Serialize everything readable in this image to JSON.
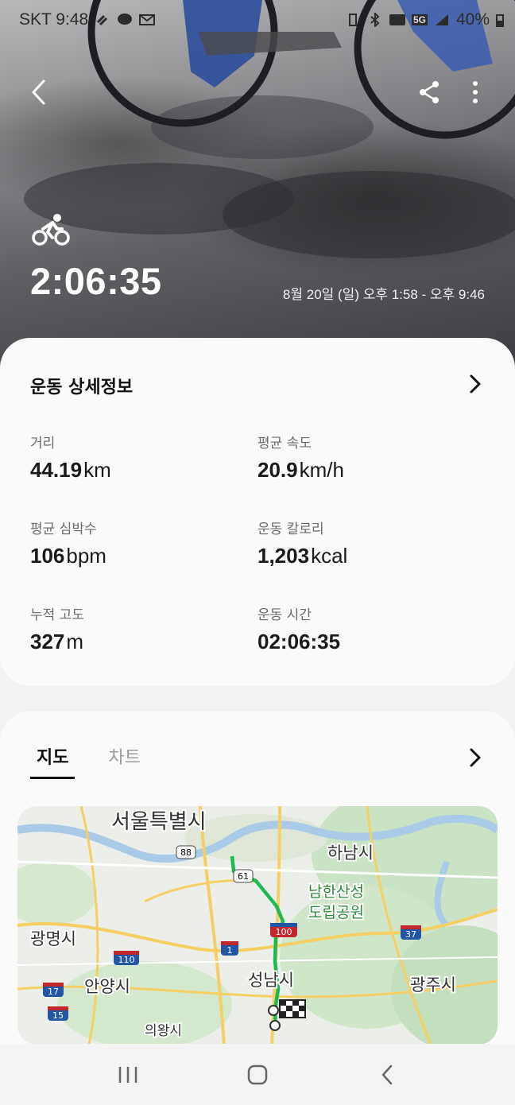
{
  "status_bar": {
    "carrier_time": "SKT 9:48",
    "battery": "40%",
    "network": "5G",
    "icons": [
      "link-icon",
      "talk-icon",
      "mail-icon",
      "vibrate-icon",
      "bluetooth-icon",
      "hd-voice-icon",
      "signal-icon",
      "battery-icon"
    ]
  },
  "header": {
    "activity_icon": "cycling-icon",
    "duration": "2:06:35",
    "date_range": "8월 20일 (일) 오후 1:58 - 오후 9:46"
  },
  "details": {
    "title": "운동 상세정보",
    "metrics": [
      {
        "label": "거리",
        "value": "44.19",
        "unit": "km"
      },
      {
        "label": "평균 속도",
        "value": "20.9",
        "unit": "km/h"
      },
      {
        "label": "평균 심박수",
        "value": "106",
        "unit": "bpm"
      },
      {
        "label": "운동 칼로리",
        "value": "1,203",
        "unit": "kcal"
      },
      {
        "label": "누적 고도",
        "value": "327",
        "unit": "m"
      },
      {
        "label": "운동 시간",
        "value": "02:06:35",
        "unit": ""
      }
    ]
  },
  "map_section": {
    "tabs": [
      {
        "label": "지도",
        "active": true
      },
      {
        "label": "차트",
        "active": false
      }
    ],
    "places": [
      "서울특별시",
      "하남시",
      "남한산성",
      "도립공원",
      "광명시",
      "안양시",
      "성남시",
      "광주시",
      "의왕시"
    ],
    "highways": [
      "88",
      "61",
      "100",
      "1",
      "110",
      "37",
      "17",
      "15"
    ],
    "route_color": "#1db954"
  },
  "colors": {
    "accent": "#111111",
    "label": "#6b6b6b",
    "route": "#1db954",
    "shield_red": "#c4262e",
    "shield_blue": "#2255a4"
  }
}
